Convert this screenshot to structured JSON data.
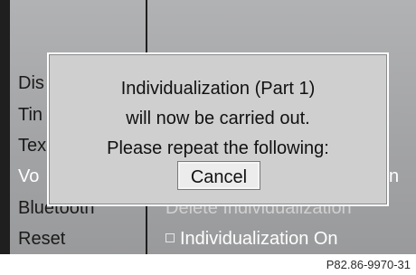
{
  "menu": {
    "items": [
      {
        "label": "Dis"
      },
      {
        "label": "Tin"
      },
      {
        "label": "Tex"
      },
      {
        "label": "Vo"
      },
      {
        "label": "Bluetooth"
      },
      {
        "label": "Reset"
      }
    ]
  },
  "right_panel": {
    "delete": "Delete Individualization",
    "individualization_on": "Individualization On",
    "suffix": "n"
  },
  "dialog": {
    "line1": "Individualization (Part 1)",
    "line2": "will now be carried out.",
    "line3": "Please repeat the following:",
    "cancel_label": "Cancel"
  },
  "caption": "P82.86-9970-31"
}
